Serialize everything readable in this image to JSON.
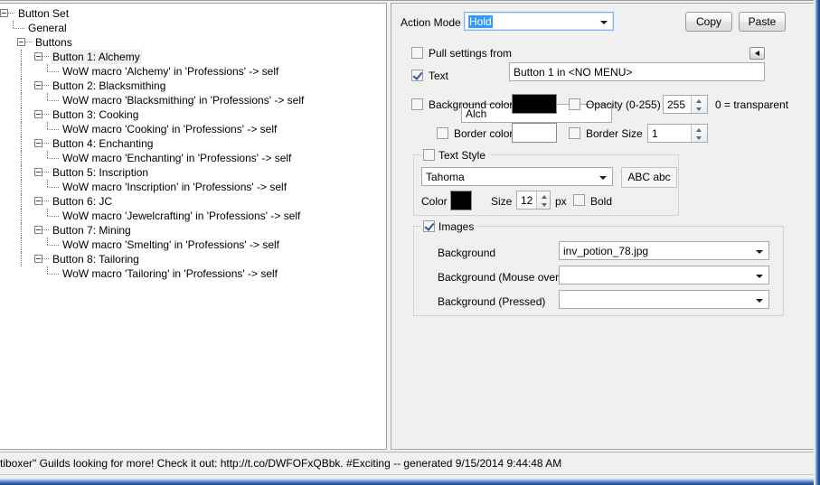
{
  "tree": {
    "root_label": "Button Set",
    "nodes": [
      {
        "label": "Button Set",
        "depth": 0,
        "type": "expanded",
        "selected": false
      },
      {
        "label": "General",
        "depth": 1,
        "type": "leaf",
        "selected": false
      },
      {
        "label": "Buttons",
        "depth": 1,
        "type": "expanded",
        "selected": false
      },
      {
        "label": "Button 1: Alchemy",
        "depth": 2,
        "type": "expanded",
        "selected": true
      },
      {
        "label": "WoW macro 'Alchemy' in 'Professions' -> self",
        "depth": 3,
        "type": "leaf",
        "selected": false
      },
      {
        "label": "Button 2: Blacksmithing",
        "depth": 2,
        "type": "expanded",
        "selected": false
      },
      {
        "label": "WoW macro 'Blacksmithing' in 'Professions' -> self",
        "depth": 3,
        "type": "leaf",
        "selected": false
      },
      {
        "label": "Button 3: Cooking",
        "depth": 2,
        "type": "expanded",
        "selected": false
      },
      {
        "label": "WoW macro 'Cooking' in 'Professions' -> self",
        "depth": 3,
        "type": "leaf",
        "selected": false
      },
      {
        "label": "Button 4: Enchanting",
        "depth": 2,
        "type": "expanded",
        "selected": false
      },
      {
        "label": "WoW macro 'Enchanting' in 'Professions' -> self",
        "depth": 3,
        "type": "leaf",
        "selected": false
      },
      {
        "label": "Button 5: Inscription",
        "depth": 2,
        "type": "expanded",
        "selected": false
      },
      {
        "label": "WoW macro 'Inscription' in 'Professions' -> self",
        "depth": 3,
        "type": "leaf",
        "selected": false
      },
      {
        "label": "Button 6: JC",
        "depth": 2,
        "type": "expanded",
        "selected": false
      },
      {
        "label": "WoW macro 'Jewelcrafting' in 'Professions' -> self",
        "depth": 3,
        "type": "leaf",
        "selected": false
      },
      {
        "label": "Button 7: Mining",
        "depth": 2,
        "type": "expanded",
        "selected": false
      },
      {
        "label": "WoW macro 'Smelting' in 'Professions' -> self",
        "depth": 3,
        "type": "leaf",
        "selected": false
      },
      {
        "label": "Button 8: Tailoring",
        "depth": 2,
        "type": "expanded",
        "selected": false
      },
      {
        "label": "WoW macro 'Tailoring' in 'Professions' -> self",
        "depth": 3,
        "type": "leaf",
        "selected": false
      }
    ]
  },
  "props": {
    "action_mode": {
      "label": "Action Mode",
      "value": "Hold",
      "selected": true
    },
    "copy_button": "Copy",
    "paste_button": "Paste",
    "pull_settings": {
      "label": "Pull settings from",
      "checked": false,
      "value": "Button 1 in <NO MENU>",
      "picker_icon": "arrow-left-icon"
    },
    "text": {
      "label": "Text",
      "checked": true,
      "value": "Alch"
    },
    "background_color": {
      "label": "Background color",
      "checked": false,
      "color": "#000000"
    },
    "opacity": {
      "label": "Opacity (0-255)",
      "checked": false,
      "value": "255",
      "hint": "0 = transparent"
    },
    "border_color": {
      "label": "Border color",
      "checked": false,
      "color": "#ffffff"
    },
    "border_size": {
      "label": "Border Size",
      "checked": false,
      "value": "1"
    },
    "text_style": {
      "label": "Text Style",
      "checked": false,
      "font": "Tahoma",
      "sample": "ABC abc",
      "color_label": "Color",
      "color": "#000000",
      "size_label": "Size",
      "size": "12",
      "size_unit": "px",
      "bold_label": "Bold",
      "bold_checked": false
    },
    "images": {
      "label": "Images",
      "checked": true,
      "background_label": "Background",
      "background_value": "inv_potion_78.jpg",
      "mouseover_label": "Background (Mouse over)",
      "mouseover_value": "",
      "pressed_label": "Background (Pressed)",
      "pressed_value": ""
    }
  },
  "statusbar": {
    "text": "tiboxer\" Guilds looking for more! Check it out: http://t.co/DWFOFxQBbk.  #Exciting -- generated 9/15/2014 9:44:48 AM"
  },
  "colors": {
    "panel_bg": "#f0f0f0",
    "selection_blue": "#3399ff",
    "window_frame": "#2a5d9e"
  }
}
